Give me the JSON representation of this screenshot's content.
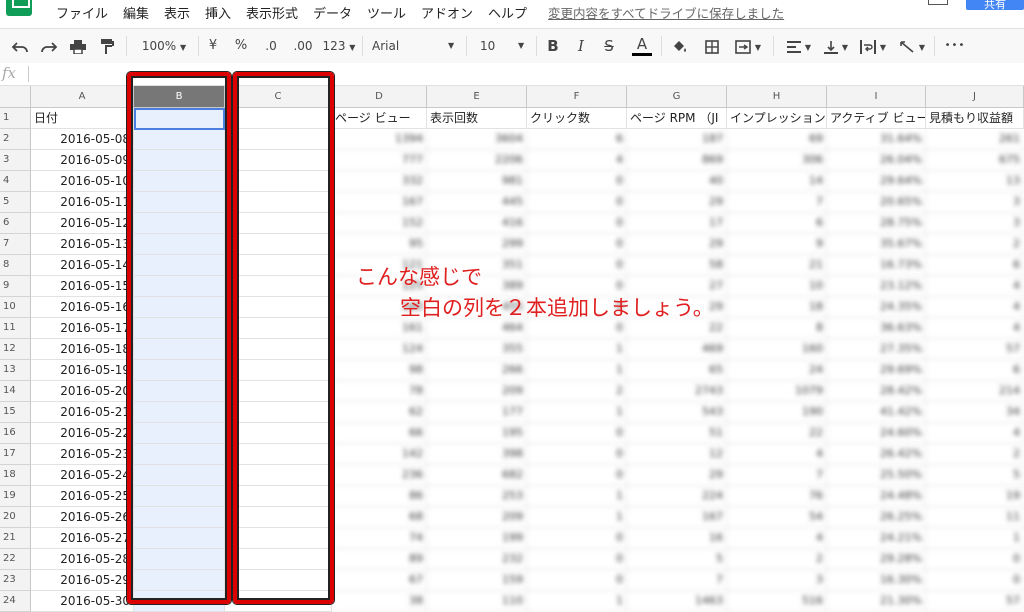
{
  "menu": {
    "items": [
      "ファイル",
      "編集",
      "表示",
      "挿入",
      "表示形式",
      "データ",
      "ツール",
      "アドオン",
      "ヘルプ"
    ],
    "save_status": "変更内容をすべてドライブに保存しました",
    "share_label": "共有"
  },
  "toolbar": {
    "zoom": "100%",
    "currency": "¥",
    "percent": "%",
    "decimal_decrease": ".0",
    "decimal_increase": ".00",
    "format_more": "123",
    "font": "Arial",
    "font_size": "10",
    "bold": "B",
    "italic": "I",
    "strikethrough": "S",
    "text_color": "A",
    "more": "•••"
  },
  "formula_bar": {
    "fx": "fx"
  },
  "columns": [
    "A",
    "B",
    "C",
    "D",
    "E",
    "F",
    "G",
    "H",
    "I",
    "J"
  ],
  "header_row": {
    "A": "日付",
    "D": "ページ ビュー",
    "E": "表示回数",
    "F": "クリック数",
    "G": "ページ RPM （JI",
    "H": "インプレッション",
    "I": "アクティブ ビュー",
    "J": "見積もり収益額"
  },
  "rows": [
    {
      "n": "1"
    },
    {
      "n": "2",
      "date": "2016-05-08",
      "d": "1394",
      "e": "3604",
      "f": "6",
      "g": "187",
      "h": "69",
      "i": "31.64%",
      "j": "261"
    },
    {
      "n": "3",
      "date": "2016-05-09",
      "d": "777",
      "e": "2206",
      "f": "4",
      "g": "869",
      "h": "306",
      "i": "26.04%",
      "j": "675"
    },
    {
      "n": "4",
      "date": "2016-05-10",
      "d": "332",
      "e": "981",
      "f": "0",
      "g": "40",
      "h": "14",
      "i": "29.64%",
      "j": "13"
    },
    {
      "n": "5",
      "date": "2016-05-11",
      "d": "167",
      "e": "445",
      "f": "0",
      "g": "29",
      "h": "7",
      "i": "20.65%",
      "j": "3"
    },
    {
      "n": "6",
      "date": "2016-05-12",
      "d": "152",
      "e": "416",
      "f": "0",
      "g": "17",
      "h": "6",
      "i": "28.75%",
      "j": "3"
    },
    {
      "n": "7",
      "date": "2016-05-13",
      "d": "95",
      "e": "299",
      "f": "0",
      "g": "29",
      "h": "9",
      "i": "35.67%",
      "j": "2"
    },
    {
      "n": "8",
      "date": "2016-05-14",
      "d": "121",
      "e": "351",
      "f": "0",
      "g": "58",
      "h": "21",
      "i": "16.73%",
      "j": "6"
    },
    {
      "n": "9",
      "date": "2016-05-15",
      "d": "125",
      "e": "389",
      "f": "0",
      "g": "27",
      "h": "10",
      "i": "23.12%",
      "j": "4"
    },
    {
      "n": "10",
      "date": "2016-05-16",
      "d": "160",
      "e": "455",
      "f": "0",
      "g": "29",
      "h": "18",
      "i": "24.35%",
      "j": "4"
    },
    {
      "n": "11",
      "date": "2016-05-17",
      "d": "161",
      "e": "464",
      "f": "0",
      "g": "22",
      "h": "8",
      "i": "36.63%",
      "j": "4"
    },
    {
      "n": "12",
      "date": "2016-05-18",
      "d": "124",
      "e": "355",
      "f": "1",
      "g": "469",
      "h": "160",
      "i": "27.35%",
      "j": "57"
    },
    {
      "n": "13",
      "date": "2016-05-19",
      "d": "98",
      "e": "266",
      "f": "1",
      "g": "65",
      "h": "24",
      "i": "29.69%",
      "j": "6"
    },
    {
      "n": "14",
      "date": "2016-05-20",
      "d": "78",
      "e": "209",
      "f": "2",
      "g": "2743",
      "h": "1079",
      "i": "28.42%",
      "j": "214"
    },
    {
      "n": "15",
      "date": "2016-05-21",
      "d": "62",
      "e": "177",
      "f": "1",
      "g": "543",
      "h": "190",
      "i": "41.42%",
      "j": "34"
    },
    {
      "n": "16",
      "date": "2016-05-22",
      "d": "66",
      "e": "195",
      "f": "0",
      "g": "51",
      "h": "22",
      "i": "24.60%",
      "j": "4"
    },
    {
      "n": "17",
      "date": "2016-05-23",
      "d": "142",
      "e": "398",
      "f": "0",
      "g": "12",
      "h": "4",
      "i": "26.42%",
      "j": "2"
    },
    {
      "n": "18",
      "date": "2016-05-24",
      "d": "236",
      "e": "682",
      "f": "0",
      "g": "29",
      "h": "7",
      "i": "25.50%",
      "j": "5"
    },
    {
      "n": "19",
      "date": "2016-05-25",
      "d": "86",
      "e": "253",
      "f": "1",
      "g": "224",
      "h": "76",
      "i": "24.48%",
      "j": "19"
    },
    {
      "n": "20",
      "date": "2016-05-26",
      "d": "68",
      "e": "209",
      "f": "1",
      "g": "167",
      "h": "54",
      "i": "26.25%",
      "j": "11"
    },
    {
      "n": "21",
      "date": "2016-05-27",
      "d": "74",
      "e": "199",
      "f": "0",
      "g": "16",
      "h": "4",
      "i": "24.21%",
      "j": "1"
    },
    {
      "n": "22",
      "date": "2016-05-28",
      "d": "89",
      "e": "232",
      "f": "0",
      "g": "5",
      "h": "2",
      "i": "29.28%",
      "j": "0"
    },
    {
      "n": "23",
      "date": "2016-05-29",
      "d": "67",
      "e": "159",
      "f": "0",
      "g": "7",
      "h": "3",
      "i": "16.30%",
      "j": "0"
    },
    {
      "n": "24",
      "date": "2016-05-30",
      "d": "38",
      "e": "110",
      "f": "1",
      "g": "1463",
      "h": "516",
      "i": "21.30%",
      "j": "57"
    }
  ],
  "annotation": {
    "line1": "こんな感じで",
    "line2": "空白の列を２本追加しましょう。",
    "color": "#e02020"
  },
  "colors": {
    "highlight_box": "#dd0000",
    "selected_column": "#e8f0fe",
    "sheets_green": "#0f9d58"
  }
}
